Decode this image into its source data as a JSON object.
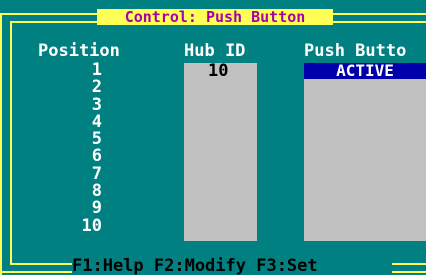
{
  "window": {
    "title": "Control: Push Button"
  },
  "columns": {
    "position_label": "Position",
    "hub_label": "Hub ID",
    "push_label": "Push Butto"
  },
  "positions": [
    "1",
    "2",
    "3",
    "4",
    "5",
    "6",
    "7",
    "8",
    "9",
    "10"
  ],
  "hub_ids": [
    "10"
  ],
  "push_buttons": [
    "ACTIVE"
  ],
  "status_bar": {
    "text": "F1:Help F2:Modify F3:Set"
  },
  "colors": {
    "background": "#008080",
    "frame": "#FFFF55",
    "title_text": "#AA00AA",
    "field_bg": "#C0C0C0",
    "highlight_bg": "#0000AA"
  }
}
